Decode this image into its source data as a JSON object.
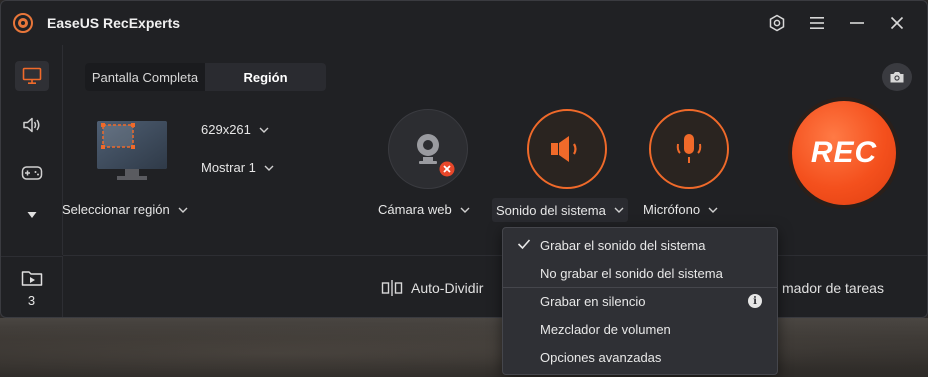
{
  "window": {
    "title": "EaseUS RecExperts"
  },
  "sidebar": {
    "items": [
      {
        "icon": "monitor-icon"
      },
      {
        "icon": "speaker-icon"
      },
      {
        "icon": "gamepad-icon"
      },
      {
        "icon": "triangle-down-icon"
      }
    ],
    "recordings_count": "3"
  },
  "tabs": [
    {
      "label": "Pantalla Completa"
    },
    {
      "label": "Región"
    }
  ],
  "region": {
    "size": "629x261",
    "display": "Mostrar 1",
    "select_label": "Seleccionar región"
  },
  "devices": {
    "webcam_label": "Cámara web",
    "system_sound_label": "Sonido del sistema",
    "microphone_label": "Micrófono"
  },
  "rec_button": "REC",
  "bottom_bar": {
    "auto_split": "Auto-Dividir",
    "task_scheduler_partial": "mador de tareas"
  },
  "menu": {
    "items": [
      {
        "label": "Grabar el sonido del sistema",
        "checked": true
      },
      {
        "label": "No grabar el sonido del sistema",
        "checked": false
      },
      {
        "label": "Grabar en silencio",
        "checked": false
      },
      {
        "label": "Mezclador de volumen",
        "checked": false
      },
      {
        "label": "Opciones avanzadas",
        "checked": false
      }
    ],
    "info_glyph": "i"
  },
  "colors": {
    "accent": "#f4501d",
    "window_bg": "#202124",
    "menu_bg": "#2f3035"
  }
}
